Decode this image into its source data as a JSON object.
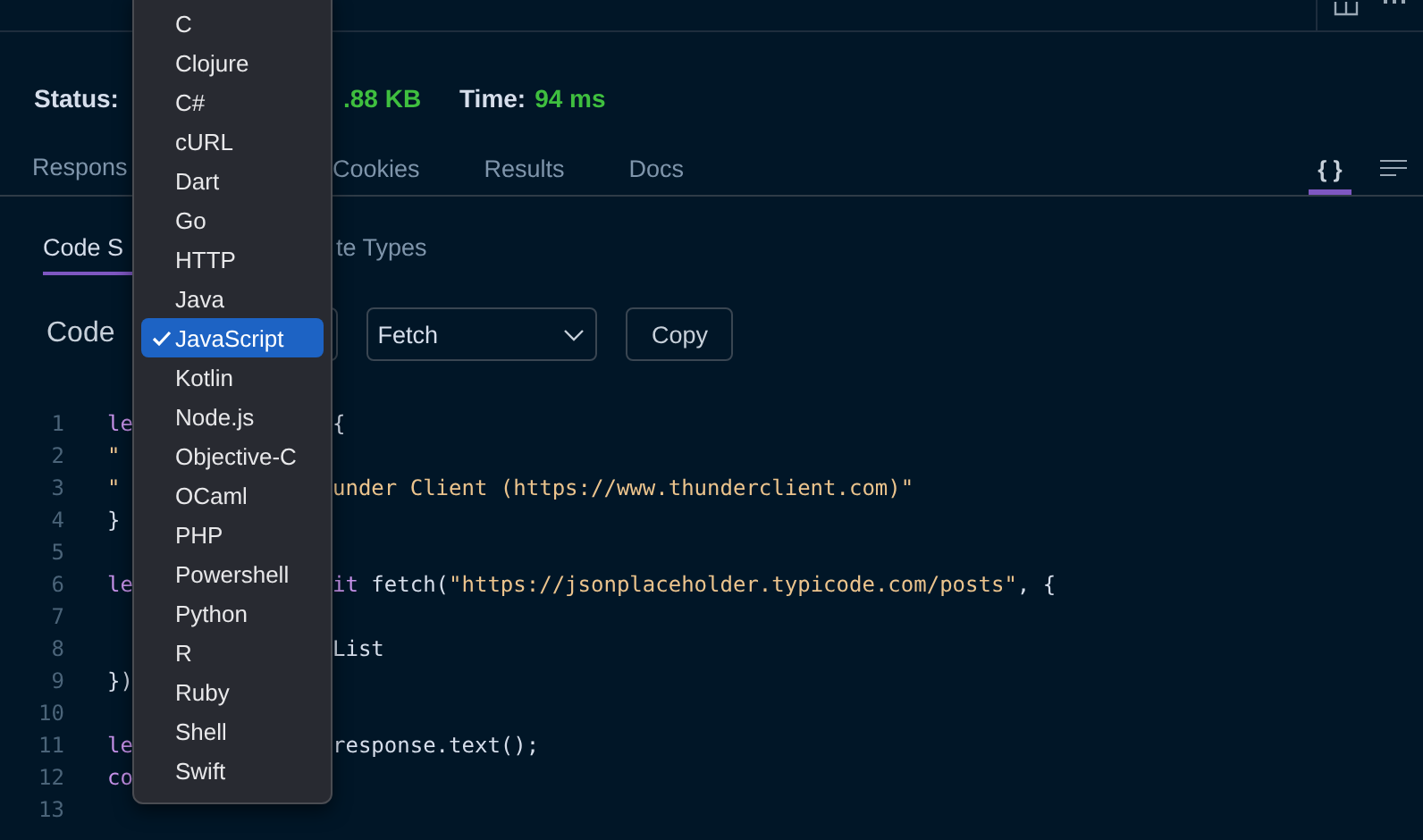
{
  "status": [
    {
      "label": "Status:"
    },
    {
      "value": ".88 KB"
    },
    {
      "label": "Time:",
      "value": "94 ms"
    }
  ],
  "response_tabs": [
    {
      "label": "Respons",
      "selected": false
    },
    {
      "label": "Cookies",
      "selected": false
    },
    {
      "label": "Results",
      "selected": false
    },
    {
      "label": "Docs",
      "selected": false
    }
  ],
  "view_toggles": [
    {
      "kind": "braces",
      "label": "{ }",
      "selected": true
    },
    {
      "kind": "lines",
      "selected": false
    }
  ],
  "sub_tabs": [
    {
      "label": "Code S",
      "selected": true
    },
    {
      "label": "te Types",
      "selected": false
    }
  ],
  "code_options": {
    "label": "Code",
    "library": "Fetch",
    "copy": "Copy"
  },
  "code_lines": [
    {
      "number": "1",
      "left": [
        {
          "text": "le",
          "kind": "keyword"
        }
      ],
      "right": [
        {
          "text": "{",
          "kind": "plain"
        }
      ]
    },
    {
      "number": "2",
      "left": [
        {
          "text": "\"",
          "kind": "string"
        }
      ]
    },
    {
      "number": "3",
      "left": [
        {
          "text": "\"",
          "kind": "string"
        }
      ],
      "right": [
        {
          "text": "under Client (https://www.thunderclient.com)\"",
          "kind": "string"
        }
      ]
    },
    {
      "number": "4",
      "left": [
        {
          "text": "}",
          "kind": "plain"
        }
      ]
    },
    {
      "number": "5"
    },
    {
      "number": "6",
      "left": [
        {
          "text": "le",
          "kind": "keyword"
        }
      ],
      "right": [
        {
          "text": "it",
          "kind": "keyword"
        },
        {
          "text": " fetch(",
          "kind": "plain"
        },
        {
          "text": "\"https://jsonplaceholder.typicode.com/posts\"",
          "kind": "string"
        },
        {
          "text": ", {",
          "kind": "plain"
        }
      ]
    },
    {
      "number": "7"
    },
    {
      "number": "8",
      "right": [
        {
          "text": "List",
          "kind": "plain"
        }
      ]
    },
    {
      "number": "9",
      "left": [
        {
          "text": "})",
          "kind": "plain"
        }
      ]
    },
    {
      "number": "10"
    },
    {
      "number": "11",
      "left": [
        {
          "text": "le",
          "kind": "keyword"
        }
      ],
      "right": [
        {
          "text": "response.text();",
          "kind": "plain"
        }
      ]
    },
    {
      "number": "12",
      "left": [
        {
          "text": "co",
          "kind": "keyword"
        }
      ]
    },
    {
      "number": "13"
    }
  ],
  "language_menu": [
    {
      "label": "C",
      "selected": false
    },
    {
      "label": "Clojure",
      "selected": false
    },
    {
      "label": "C#",
      "selected": false
    },
    {
      "label": "cURL",
      "selected": false
    },
    {
      "label": "Dart",
      "selected": false
    },
    {
      "label": "Go",
      "selected": false
    },
    {
      "label": "HTTP",
      "selected": false
    },
    {
      "label": "Java",
      "selected": false
    },
    {
      "label": "JavaScript",
      "selected": true
    },
    {
      "label": "Kotlin",
      "selected": false
    },
    {
      "label": "Node.js",
      "selected": false
    },
    {
      "label": "Objective-C",
      "selected": false
    },
    {
      "label": "OCaml",
      "selected": false
    },
    {
      "label": "PHP",
      "selected": false
    },
    {
      "label": "Powershell",
      "selected": false
    },
    {
      "label": "Python",
      "selected": false
    },
    {
      "label": "R",
      "selected": false
    },
    {
      "label": "Ruby",
      "selected": false
    },
    {
      "label": "Shell",
      "selected": false
    },
    {
      "label": "Swift",
      "selected": false
    }
  ]
}
